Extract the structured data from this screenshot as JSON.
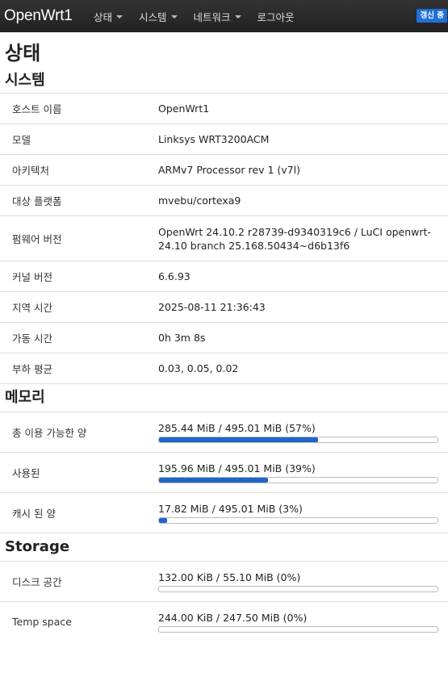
{
  "nav": {
    "brand": "OpenWrt1",
    "menu": [
      "상태",
      "시스템",
      "네트워크",
      "로그아웃"
    ],
    "refresh_badge": "갱신 중",
    "accent": "#1f6fd6"
  },
  "page_title": "상태",
  "system": {
    "title": "시스템",
    "rows": [
      {
        "label": "호스트 이름",
        "value": "OpenWrt1"
      },
      {
        "label": "모델",
        "value": "Linksys WRT3200ACM"
      },
      {
        "label": "아키텍처",
        "value": "ARMv7 Processor rev 1 (v7l)"
      },
      {
        "label": "대상 플랫폼",
        "value": "mvebu/cortexa9"
      },
      {
        "label": "펌웨어 버전",
        "value": "OpenWrt 24.10.2 r28739-d9340319c6 / LuCI openwrt-24.10 branch 25.168.50434~d6b13f6"
      },
      {
        "label": "커널 버전",
        "value": "6.6.93"
      },
      {
        "label": "지역 시간",
        "value": "2025-08-11 21:36:43"
      },
      {
        "label": "가동 시간",
        "value": "0h 3m 8s"
      },
      {
        "label": "부하 평균",
        "value": "0.03, 0.05, 0.02"
      }
    ]
  },
  "memory": {
    "title": "메모리",
    "rows": [
      {
        "label": "총 이용 가능한 양",
        "value": "285.44 MiB / 495.01 MiB (57%)",
        "fraction": 0.57
      },
      {
        "label": "사용된",
        "value": "195.96 MiB / 495.01 MiB (39%)",
        "fraction": 0.39
      },
      {
        "label": "캐시 된 양",
        "value": "17.82 MiB / 495.01 MiB (3%)",
        "fraction": 0.03
      }
    ]
  },
  "storage": {
    "title": "Storage",
    "rows": [
      {
        "label": "디스크 공간",
        "value": "132.00 KiB / 55.10 MiB (0%)",
        "fraction": 0.0
      },
      {
        "label": "Temp space",
        "value": "244.00 KiB / 247.50 MiB (0%)",
        "fraction": 0.0
      }
    ]
  }
}
